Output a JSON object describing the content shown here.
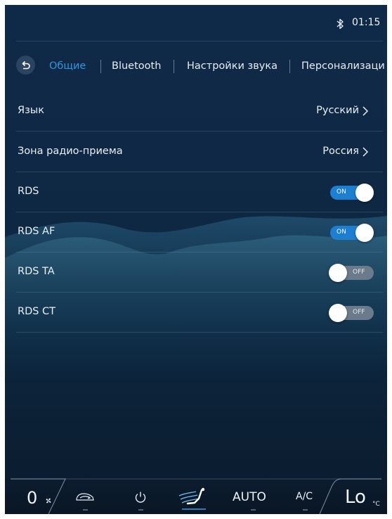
{
  "status": {
    "time": "01:15",
    "bluetooth_icon": "bluetooth-icon"
  },
  "tabs": [
    {
      "label": "Общие",
      "active": true
    },
    {
      "label": "Bluetooth",
      "active": false
    },
    {
      "label": "Настройки звука",
      "active": false
    },
    {
      "label": "Персонализаци",
      "active": false
    }
  ],
  "settings": {
    "language": {
      "label": "Язык",
      "value": "Русский"
    },
    "radio_zone": {
      "label": "Зона радио-приема",
      "value": "Россия"
    },
    "rds": {
      "label": "RDS",
      "state": "ON"
    },
    "rds_af": {
      "label": "RDS AF",
      "state": "ON"
    },
    "rds_ta": {
      "label": "RDS TA",
      "state": "OFF"
    },
    "rds_ct": {
      "label": "RDS CT",
      "state": "OFF"
    }
  },
  "climate": {
    "fan_speed": "0",
    "auto": "AUTO",
    "ac": "A/C",
    "temperature": "Lo",
    "temperature_unit": "°C"
  },
  "colors": {
    "accent": "#2f95de",
    "toggle_on": "#1d7fd2",
    "toggle_off": "#6c7b8b"
  }
}
